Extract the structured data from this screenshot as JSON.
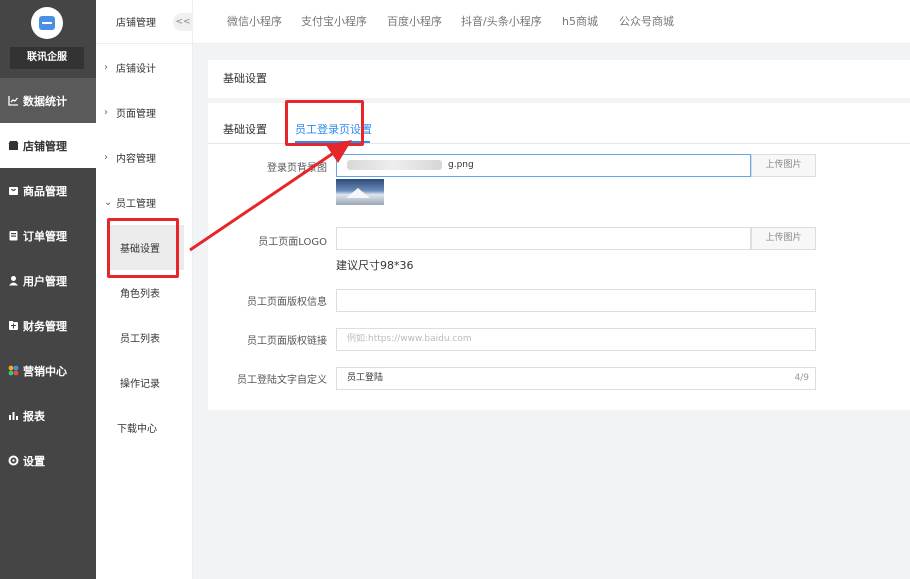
{
  "sidebar": {
    "company": "联讯企服",
    "items": [
      {
        "label": "数据统计",
        "icon": "line-chart-icon"
      },
      {
        "label": "店铺管理",
        "icon": "store-icon"
      },
      {
        "label": "商品管理",
        "icon": "goods-icon"
      },
      {
        "label": "订单管理",
        "icon": "order-icon"
      },
      {
        "label": "用户管理",
        "icon": "user-icon"
      },
      {
        "label": "财务管理",
        "icon": "finance-icon"
      },
      {
        "label": "营销中心",
        "icon": "marketing-icon"
      },
      {
        "label": "报表",
        "icon": "bar-chart-icon"
      },
      {
        "label": "设置",
        "icon": "gear-icon"
      }
    ]
  },
  "subnav": {
    "title": "店铺管理",
    "collapse_label": "<<",
    "items": [
      {
        "label": "店铺设计"
      },
      {
        "label": "页面管理"
      },
      {
        "label": "内容管理"
      },
      {
        "label": "员工管理"
      }
    ],
    "children": [
      {
        "label": "基础设置"
      },
      {
        "label": "角色列表"
      },
      {
        "label": "员工列表"
      },
      {
        "label": "操作记录"
      }
    ],
    "download": "下载中心"
  },
  "topbar": {
    "tabs": [
      "微信小程序",
      "支付宝小程序",
      "百度小程序",
      "抖音/头条小程序",
      "h5商城",
      "公众号商城"
    ]
  },
  "main": {
    "section_title": "基础设置",
    "tabs": [
      "基础设置",
      "员工登录页设置"
    ],
    "form": {
      "bg_label": "登录页背景图",
      "bg_value": "g.png",
      "upload_label": "上传图片",
      "logo_label": "员工页面LOGO",
      "logo_value": "",
      "logo_hint": "建议尺寸98*36",
      "copyright_label": "员工页面版权信息",
      "copyright_value": "",
      "copyright_link_label": "员工页面版权链接",
      "copyright_link_placeholder": "例如:https://www.baidu.com",
      "custom_text_label": "员工登陆文字自定义",
      "custom_text_value": "员工登陆",
      "custom_text_counter": "4/9"
    }
  },
  "colors": {
    "sidebar_bg": "#454545",
    "accent": "#2d8cf0",
    "annotation": "#e5262a"
  }
}
